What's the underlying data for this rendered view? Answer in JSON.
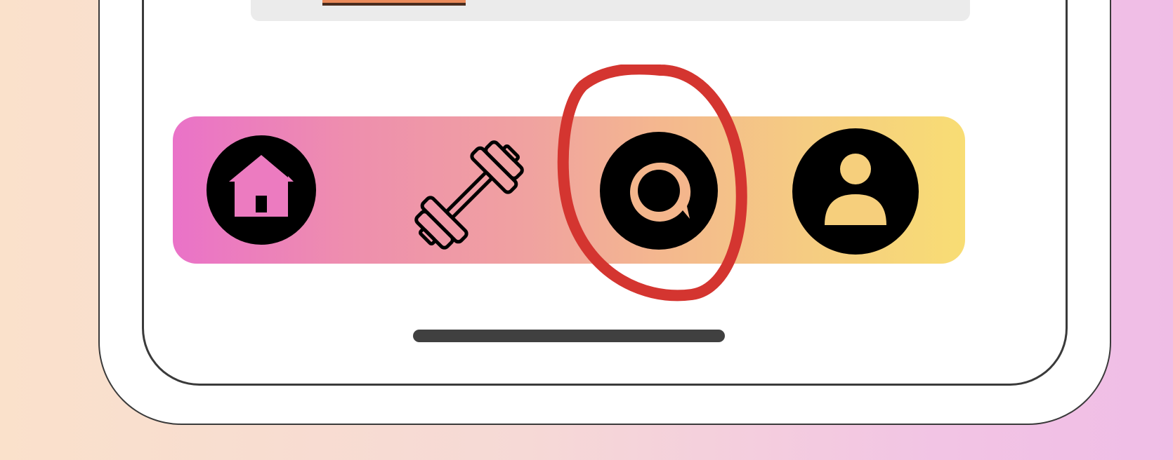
{
  "app": {
    "bottom_nav": {
      "items": [
        {
          "id": "home",
          "icon": "home-icon",
          "selected": false
        },
        {
          "id": "workout",
          "icon": "dumbbell-icon",
          "selected": false
        },
        {
          "id": "chat",
          "icon": "chat-bubble-icon",
          "selected": false
        },
        {
          "id": "profile",
          "icon": "person-icon",
          "selected": false
        }
      ],
      "gradient": [
        "#ea72c8",
        "#f0a2a0",
        "#f5cc82",
        "#f8dd74"
      ]
    },
    "annotation": {
      "shape": "hand-drawn-circle",
      "target": "chat",
      "color": "#d43530"
    }
  },
  "colors": {
    "icon_fill": "#000000",
    "phone_frame": "#3a3a3a",
    "screen_bg": "#ffffff",
    "card_bg": "#ebebeb"
  }
}
